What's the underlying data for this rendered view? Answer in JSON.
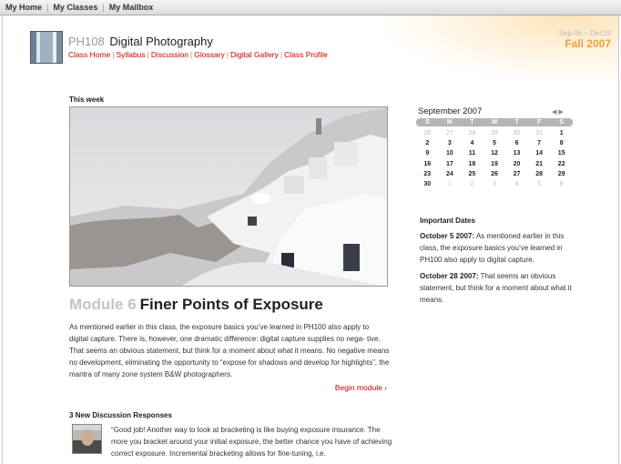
{
  "topnav": {
    "items": [
      "My Home",
      "My Classes",
      "My Mailbox"
    ],
    "separator": "|"
  },
  "course": {
    "code": "PH108",
    "title": "Digital Photography",
    "nav": [
      "Class Home",
      "Syllabus",
      "Discussion",
      "Glossary",
      "Digital Gallery",
      "Class Profile"
    ],
    "nav_separator": "|"
  },
  "term": {
    "dates": "Sep 06 – Dec19",
    "name": "Fall 2007",
    "accent": "#e8a33a"
  },
  "this_week": {
    "label": "This week",
    "module_number": "Module 6",
    "module_title": "Finer Points of Exposure",
    "description": "As mentioned earlier in this class, the exposure basics you’ve learned in PH100 also apply to digital capture. There is, however, one dramatic difference: digital capture supplies no nega- tive. That seems an obvious statement, but think for a moment about what it means. No negative means no development, eliminating the opportunity to “expose for shadows and develop for highlights”, the mantra of many zone system B&W photographers.",
    "begin_link": "Begin module ›"
  },
  "discussion": {
    "heading": "3 New Discussion Responses",
    "comment": "“Good job! Another way to look at bracketing is like buying exposure insurance. The more you bracket around your initial exposure, the better chance you have of achieving correct exposure. Incremental bracketing allows for fine-tuning, i.e."
  },
  "calendar": {
    "month": "September 2007",
    "weekdays": [
      "S",
      "M",
      "T",
      "W",
      "T",
      "F",
      "S"
    ],
    "weeks": [
      [
        {
          "d": "26",
          "m": true
        },
        {
          "d": "27",
          "m": true
        },
        {
          "d": "28",
          "m": true
        },
        {
          "d": "29",
          "m": true
        },
        {
          "d": "30",
          "m": true
        },
        {
          "d": "31",
          "m": true
        },
        {
          "d": "1",
          "m": false
        }
      ],
      [
        {
          "d": "2",
          "m": false
        },
        {
          "d": "3",
          "m": false
        },
        {
          "d": "4",
          "m": false
        },
        {
          "d": "5",
          "m": false
        },
        {
          "d": "6",
          "m": false
        },
        {
          "d": "7",
          "m": false
        },
        {
          "d": "8",
          "m": false
        }
      ],
      [
        {
          "d": "9",
          "m": false
        },
        {
          "d": "10",
          "m": false
        },
        {
          "d": "11",
          "m": false
        },
        {
          "d": "12",
          "m": false
        },
        {
          "d": "13",
          "m": false
        },
        {
          "d": "14",
          "m": false
        },
        {
          "d": "15",
          "m": false
        }
      ],
      [
        {
          "d": "16",
          "m": false
        },
        {
          "d": "17",
          "m": false
        },
        {
          "d": "18",
          "m": false
        },
        {
          "d": "19",
          "m": false
        },
        {
          "d": "20",
          "m": false
        },
        {
          "d": "21",
          "m": false
        },
        {
          "d": "22",
          "m": false
        }
      ],
      [
        {
          "d": "23",
          "m": false
        },
        {
          "d": "24",
          "m": false
        },
        {
          "d": "25",
          "m": false
        },
        {
          "d": "26",
          "m": false
        },
        {
          "d": "27",
          "m": false
        },
        {
          "d": "28",
          "m": false
        },
        {
          "d": "29",
          "m": false
        }
      ],
      [
        {
          "d": "30",
          "m": false
        },
        {
          "d": "1",
          "m": true
        },
        {
          "d": "2",
          "m": true
        },
        {
          "d": "3",
          "m": true
        },
        {
          "d": "4",
          "m": true
        },
        {
          "d": "5",
          "m": true
        },
        {
          "d": "6",
          "m": true
        }
      ]
    ]
  },
  "important_dates": {
    "title": "Important Dates",
    "items": [
      {
        "date": "October 5 2007:",
        "text": " As mentioned earlier in this class, the exposure basics you’ve learned in PH100 also apply to digital capture."
      },
      {
        "date": "October 28 2007:",
        "text": " That seems an obvious statement, but think for a moment about what it means."
      }
    ]
  },
  "colors": {
    "link": "#cc0000",
    "muted": "#c4c4c4"
  }
}
